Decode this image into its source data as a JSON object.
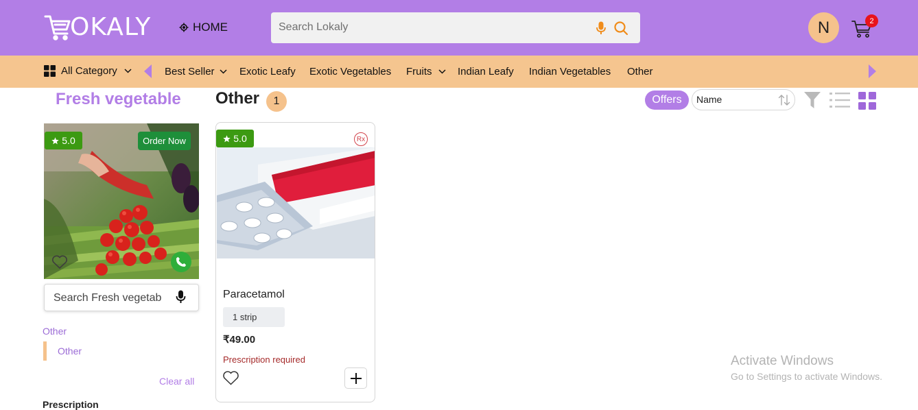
{
  "header": {
    "logo_text": "OKALY",
    "home_label": "HOME",
    "search_placeholder": "Search Lokaly",
    "avatar_initial": "N",
    "cart_count": "2"
  },
  "category_bar": {
    "all_category_label": "All Category",
    "items": [
      {
        "label": "Best Seller",
        "has_dropdown": true
      },
      {
        "label": "Exotic Leafy",
        "has_dropdown": false
      },
      {
        "label": "Exotic Vegetables",
        "has_dropdown": false
      },
      {
        "label": "Fruits",
        "has_dropdown": true
      },
      {
        "label": "Indian Leafy",
        "has_dropdown": false
      },
      {
        "label": "Indian Vegetables",
        "has_dropdown": false
      },
      {
        "label": "Other",
        "has_dropdown": false
      }
    ]
  },
  "sidebar": {
    "store_title": "Fresh vegetable",
    "store_rating": "5.0",
    "order_now_label": "Order Now",
    "store_search_placeholder": "Search Fresh vegetab",
    "filter_heading": "Other",
    "filter_items": [
      "Other"
    ],
    "clear_all_label": "Clear all",
    "prescription_heading": "Prescription"
  },
  "main": {
    "category_title": "Other",
    "product_count": "1",
    "offers_label": "Offers",
    "sort_value": "Name",
    "products": [
      {
        "rating": "5.0",
        "rx_label": "Rx",
        "name": "Paracetamol",
        "unit": "1 strip",
        "price": "₹49.00",
        "note": "Prescription required"
      }
    ]
  },
  "watermark": {
    "title": "Activate Windows",
    "subtitle": "Go to Settings to activate Windows."
  },
  "colors": {
    "header_bg": "#b27ee6",
    "category_bar_bg": "#f5c58f",
    "accent_purple": "#b27ee6",
    "badge_peach": "#f5c28c",
    "rating_green": "#3c9a12",
    "cart_badge_red": "#e8141b",
    "prescription_red": "#a52a2a"
  },
  "icons": {
    "logo": "cart-logo-icon",
    "home": "location-target-icon",
    "mic": "microphone-icon",
    "search": "search-icon",
    "cart": "shopping-cart-icon",
    "grid": "grid-icon",
    "filter": "filter-funnel-icon",
    "list_view": "list-view-icon",
    "grid_view": "grid-view-icon",
    "heart": "heart-icon",
    "phone": "phone-icon",
    "add": "plus-icon",
    "star": "star-icon",
    "sort": "sort-arrows-icon"
  }
}
